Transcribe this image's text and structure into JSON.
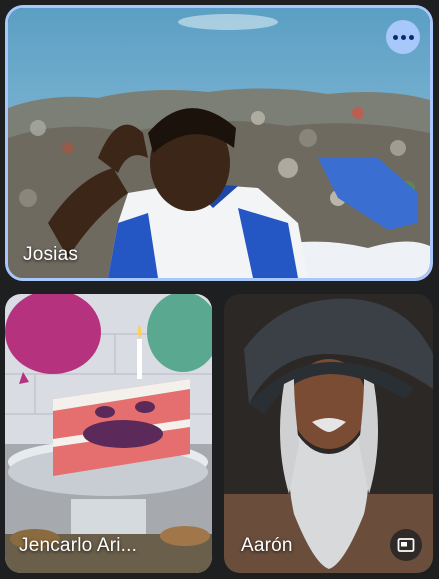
{
  "participants": [
    {
      "name": "Josias",
      "active": true,
      "more_icon": "more-horiz-icon"
    },
    {
      "name": "Jencarlo Ari..."
    },
    {
      "name": "Aarón",
      "pip_icon": "picture-in-picture-icon"
    }
  ],
  "colors": {
    "background": "#1e1f20",
    "active_border": "#a8c7fa",
    "more_button": "#a8c7fa"
  }
}
